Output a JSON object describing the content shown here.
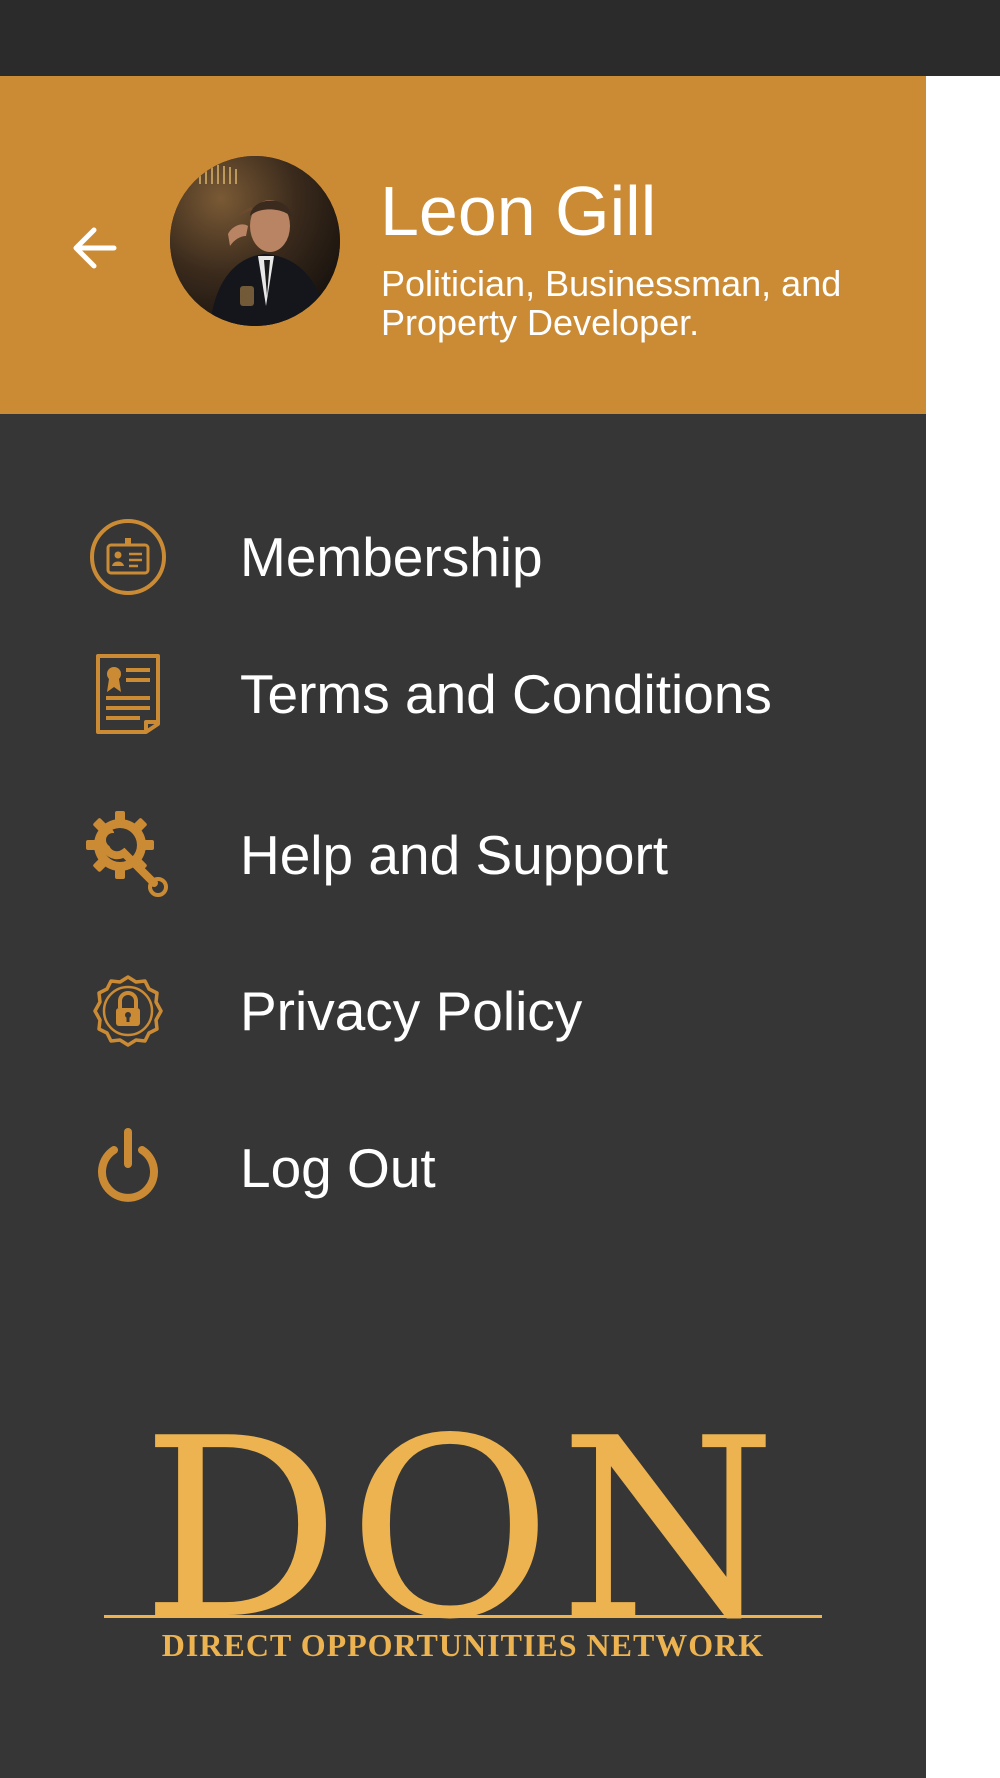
{
  "profile": {
    "name": "Leon Gill",
    "bio": "Politician, Businessman, and Property Developer.",
    "back_icon": "arrow-left-icon",
    "avatar": "profile-photo"
  },
  "menu": {
    "items": [
      {
        "label": "Membership",
        "icon": "id-card-icon"
      },
      {
        "label": "Terms and Conditions",
        "icon": "certificate-document-icon"
      },
      {
        "label": "Help and Support",
        "icon": "gear-wrench-icon"
      },
      {
        "label": "Privacy Policy",
        "icon": "lock-badge-icon"
      },
      {
        "label": "Log Out",
        "icon": "power-icon"
      }
    ]
  },
  "logo": {
    "title": "DON",
    "tagline": "DIRECT OPPORTUNITIES NETWORK"
  },
  "colors": {
    "header_bg": "#cb8b34",
    "drawer_bg": "#363636",
    "status_bar_bg": "#2b2b2b",
    "icon_accent": "#cb8b34",
    "logo_gold": "#ecb350",
    "text": "#ffffff"
  }
}
